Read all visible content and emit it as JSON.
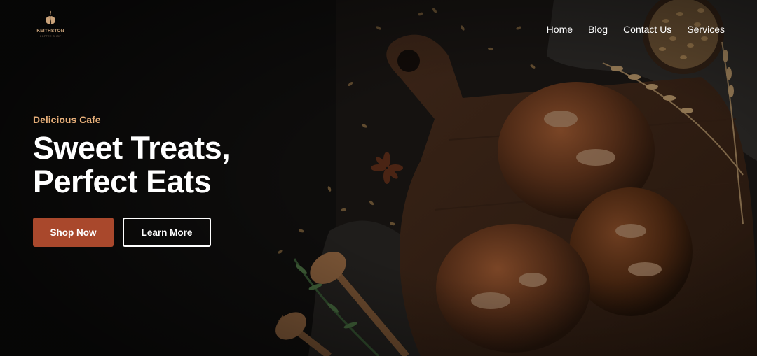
{
  "brand": {
    "name": "KEITHSTON",
    "tagline": "COFFEE SHOP",
    "icon": "coffee-bean-icon"
  },
  "nav": {
    "items": [
      {
        "label": "Home"
      },
      {
        "label": "Blog"
      },
      {
        "label": "Contact Us"
      },
      {
        "label": "Services"
      }
    ]
  },
  "hero": {
    "eyebrow": "Delicious Cafe",
    "headline_line1": "Sweet Treats,",
    "headline_line2": "Perfect Eats",
    "primary_button": "Shop Now",
    "secondary_button": "Learn More"
  },
  "colors": {
    "accent": "#a9482c",
    "eyebrow": "#e8b07a",
    "text": "#ffffff",
    "background": "#0d0c0b"
  }
}
